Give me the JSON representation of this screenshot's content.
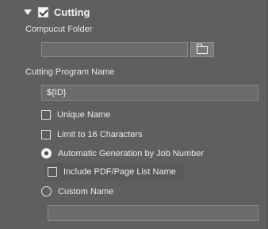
{
  "section": {
    "title": "Cutting",
    "enabled": true,
    "expanded": true
  },
  "compucut_folder": {
    "label": "Compucut Folder",
    "value": "",
    "browse_icon": "folder-icon"
  },
  "cutting_program": {
    "label": "Cutting Program Name",
    "value": "${ID}"
  },
  "options": {
    "unique_name": {
      "label": "Unique Name",
      "checked": false
    },
    "limit_16": {
      "label": "Limit to 16 Characters",
      "checked": false
    },
    "auto_generation": {
      "label": "Automatic Generation by Job Number",
      "selected": true
    },
    "include_pdf": {
      "label": "Include PDF/Page List Name",
      "checked": false
    },
    "custom_name": {
      "label": "Custom Name",
      "selected": false,
      "value": ""
    }
  }
}
